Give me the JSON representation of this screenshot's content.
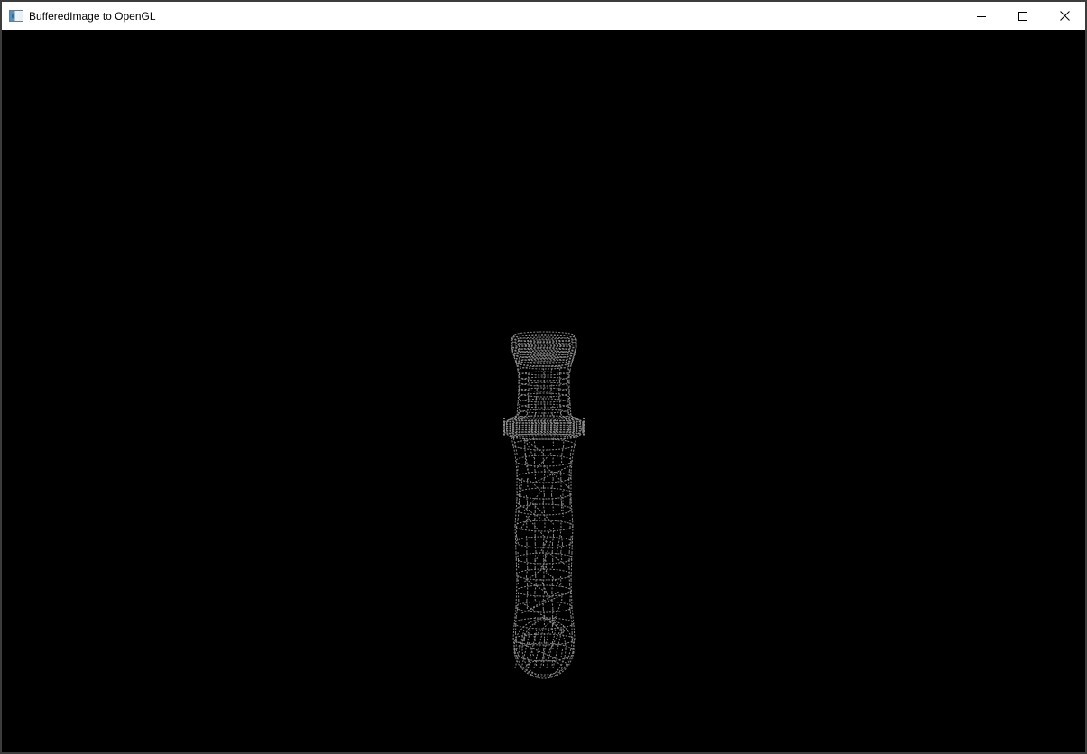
{
  "window": {
    "title": "BufferedImage to OpenGL",
    "icon": "java-app-icon",
    "controls": {
      "minimize": "minimize-icon",
      "maximize": "maximize-icon",
      "close": "close-icon"
    }
  },
  "viewport": {
    "background_color": "#000000",
    "mesh_color": "#8a8a8a",
    "render_mode": "wireframe",
    "model": "cylindrical shaft with collar, rings and rounded bottom cap"
  }
}
